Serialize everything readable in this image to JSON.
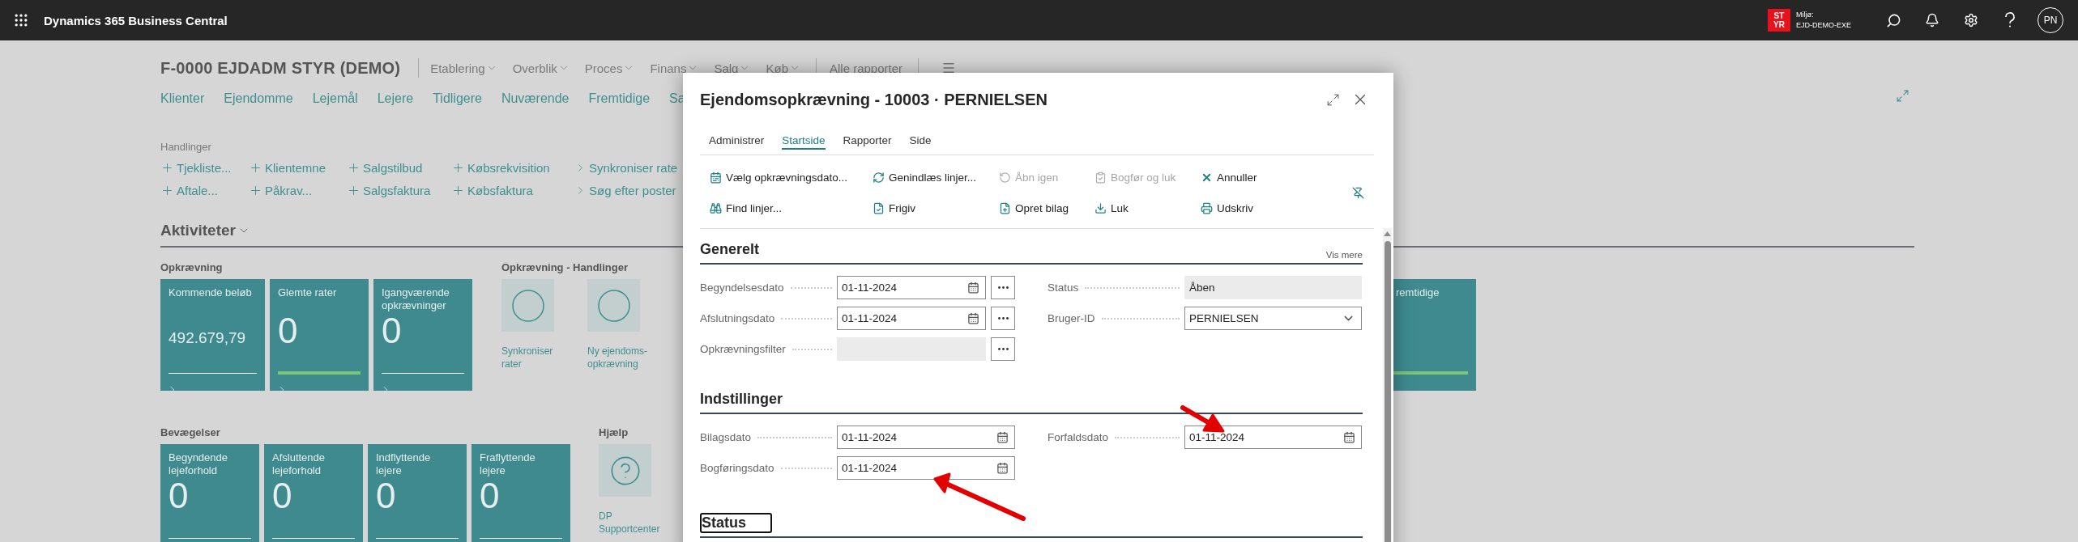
{
  "topbar": {
    "app_title": "Dynamics 365 Business Central",
    "environment": {
      "badge_lines": [
        "ST",
        "YR"
      ],
      "label": "Miljø:",
      "name": "EJD-DEMO-EXE"
    },
    "avatar": "PN"
  },
  "page": {
    "title": "F-0000 EJDADM STYR (DEMO)",
    "menus": [
      {
        "label": "Etablering",
        "kind": "dropdown"
      },
      {
        "label": "Overblik",
        "kind": "dropdown"
      },
      {
        "label": "Proces",
        "kind": "dropdown"
      },
      {
        "label": "Finans",
        "kind": "dropdown"
      },
      {
        "label": "Salg",
        "kind": "dropdown"
      },
      {
        "label": "Køb",
        "kind": "dropdown"
      },
      {
        "label": "Alle rapporter",
        "kind": "link"
      }
    ],
    "nav_links": [
      "Klienter",
      "Ejendomme",
      "Lejemål",
      "Lejere",
      "Tidligere",
      "Nuværende",
      "Fremtidige",
      "Sa"
    ],
    "actions_label": "Handlinger",
    "action_columns": [
      [
        {
          "label": "Tjekliste...",
          "kind": "new"
        },
        {
          "label": "Aftale...",
          "kind": "new"
        }
      ],
      [
        {
          "label": "Klientemne",
          "kind": "new"
        },
        {
          "label": "Påkrav...",
          "kind": "new"
        }
      ],
      [
        {
          "label": "Salgstilbud",
          "kind": "new"
        },
        {
          "label": "Salgsfaktura",
          "kind": "new"
        }
      ],
      [
        {
          "label": "Købsrekvisition",
          "kind": "new"
        },
        {
          "label": "Købsfaktura",
          "kind": "new"
        }
      ],
      [
        {
          "label": "Synkroniser rate",
          "kind": "open"
        },
        {
          "label": "Søg efter poster",
          "kind": "open"
        }
      ]
    ],
    "activities_title": "Aktiviteter",
    "rows": [
      {
        "groups": [
          {
            "title": "Opkrævning",
            "kind": "cues",
            "tiles": [
              {
                "title": "Kommende beløb",
                "value": "492.679,79",
                "color": "#f2f2f2"
              },
              {
                "title": "Glemte rater",
                "value": "0",
                "color": "#7cc576"
              },
              {
                "title": "Igangværende opkrævninger",
                "value": "0",
                "color": "#f2f2f2"
              }
            ]
          },
          {
            "title": "Opkrævning - Handlinger",
            "kind": "actions",
            "tiles": [
              {
                "title": "Synkroniser rater",
                "kind": "circle"
              },
              {
                "title": "Ny ejendoms-opkrævning",
                "kind": "circle"
              }
            ]
          },
          {
            "kind": "partial",
            "tiles": [
              {
                "title": "remtidige",
                "color": "#7cc576"
              }
            ]
          }
        ]
      },
      {
        "groups": [
          {
            "title": "Bevægelser",
            "kind": "cues",
            "tiles": [
              {
                "title": "Begyndende lejeforhold",
                "value": "0",
                "color": "#f2f2f2"
              },
              {
                "title": "Afsluttende lejeforhold",
                "value": "0",
                "color": "#f2f2f2"
              },
              {
                "title": "Indflyttende lejere",
                "value": "0",
                "color": "#f2f2f2"
              },
              {
                "title": "Fraflyttende lejere",
                "value": "0",
                "color": "#f2f2f2"
              }
            ]
          },
          {
            "title": "Hjælp",
            "kind": "actions",
            "tiles": [
              {
                "title": "DP Supportcenter",
                "kind": "help"
              }
            ]
          }
        ]
      }
    ]
  },
  "dialog": {
    "title": "Ejendomsopkrævning - 10003 · PERNIELSEN",
    "tabs": [
      {
        "label": "Administrer",
        "selected": false
      },
      {
        "label": "Startside",
        "selected": true
      },
      {
        "label": "Rapporter",
        "selected": false
      },
      {
        "label": "Side",
        "selected": false
      }
    ],
    "actions": [
      {
        "label": "Vælg opkrævningsdato...",
        "kind": "choose-date",
        "disabled": false
      },
      {
        "label": "Genindlæs linjer...",
        "kind": "reload",
        "disabled": false
      },
      {
        "label": "Åbn igen",
        "kind": "reopen",
        "disabled": true
      },
      {
        "label": "Bogfør og luk",
        "kind": "post",
        "disabled": true
      },
      {
        "label": "Annuller",
        "kind": "cancel",
        "disabled": false
      },
      {
        "label": "Find linjer...",
        "kind": "find",
        "disabled": false
      },
      {
        "label": "Frigiv",
        "kind": "release",
        "disabled": false
      },
      {
        "label": "Opret bilag",
        "kind": "create",
        "disabled": false
      },
      {
        "label": "Luk",
        "kind": "close",
        "disabled": false
      },
      {
        "label": "Udskriv",
        "kind": "print",
        "disabled": false
      }
    ],
    "sections": [
      {
        "title": "Generelt",
        "more_link": "Vis mere",
        "focused": false,
        "left": [
          {
            "label": "Begyndelsesdato",
            "kind": "date",
            "value": "01-11-2024",
            "lookup": true
          },
          {
            "label": "Afslutningsdato",
            "kind": "date",
            "value": "01-11-2024",
            "lookup": true
          },
          {
            "label": "Opkrævningsfilter",
            "kind": "readonly",
            "lookup": true
          }
        ],
        "right": [
          {
            "label": "Status",
            "kind": "readonly",
            "value": "Åben",
            "lookup": false
          },
          {
            "label": "Bruger-ID",
            "kind": "dropdown",
            "value": "PERNIELSEN",
            "lookup": false
          }
        ]
      },
      {
        "title": "Indstillinger",
        "focused": false,
        "left": [
          {
            "label": "Bilagsdato",
            "kind": "date",
            "value": "01-11-2024",
            "lookup": false
          },
          {
            "label": "Bogføringsdato",
            "kind": "date",
            "value": "01-11-2024",
            "lookup": false
          }
        ],
        "right": [
          {
            "label": "Forfaldsdato",
            "kind": "date",
            "value": "01-11-2024",
            "lookup": false
          }
        ]
      },
      {
        "title": "Status",
        "focused": true
      }
    ]
  }
}
